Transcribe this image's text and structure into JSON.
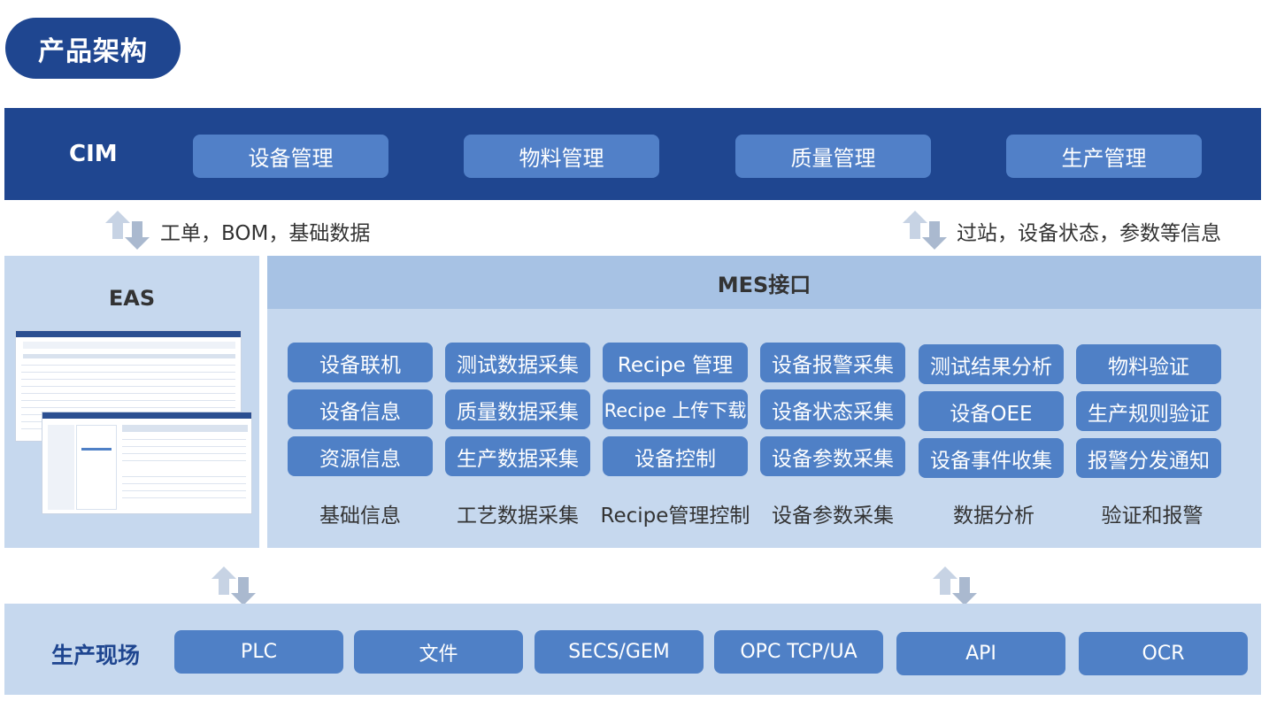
{
  "title": "产品架构",
  "cim": {
    "label": "CIM",
    "modules": [
      "设备管理",
      "物料管理",
      "质量管理",
      "生产管理"
    ]
  },
  "flows": {
    "left": "工单，BOM，基础数据",
    "right": "过站，设备状态，参数等信息"
  },
  "eas": {
    "title": "EAS"
  },
  "mes": {
    "title": "MES接口",
    "columns": [
      {
        "label": "基础信息",
        "items": [
          "设备联机",
          "设备信息",
          "资源信息"
        ]
      },
      {
        "label": "工艺数据采集",
        "items": [
          "测试数据采集",
          "质量数据采集",
          "生产数据采集"
        ]
      },
      {
        "label": "Recipe管理控制",
        "items": [
          "Recipe 管理",
          "Recipe 上传下载",
          "设备控制"
        ]
      },
      {
        "label": "设备参数采集",
        "items": [
          "设备报警采集",
          "设备状态采集",
          "设备参数采集"
        ]
      },
      {
        "label": "数据分析",
        "items": [
          "测试结果分析",
          "设备OEE",
          "设备事件收集"
        ]
      },
      {
        "label": "验证和报警",
        "items": [
          "物料验证",
          "生产规则验证",
          "报警分发通知"
        ]
      }
    ]
  },
  "field": {
    "label": "生产现场",
    "items": [
      "PLC",
      "文件",
      "SECS/GEM",
      "OPC TCP/UA",
      "API",
      "OCR"
    ]
  },
  "colors": {
    "dark_blue": "#1f4690",
    "button_blue": "#4f80c6",
    "panel_light": "#c6d8ee",
    "header_light": "#a7c2e4"
  },
  "icons": {
    "sync_arrows": "up-down-sync-arrows-icon"
  }
}
